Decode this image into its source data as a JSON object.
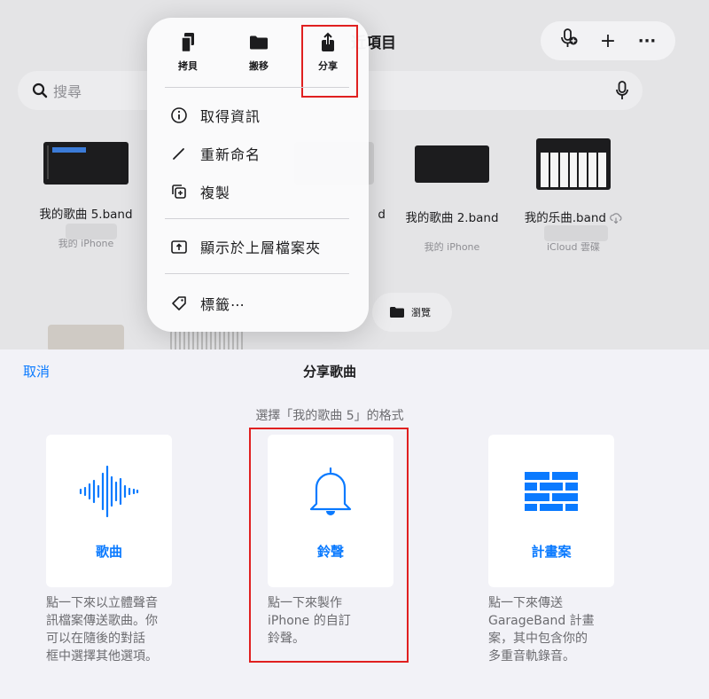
{
  "background": {
    "title_partial": "近項目",
    "search_placeholder": "搜尋",
    "toolbar": {
      "mic_add_icon": "mic-plus-icon",
      "add_icon": "plus-icon",
      "more_icon": "ellipsis-icon",
      "add_label": "+",
      "more_label": "···"
    },
    "files": [
      {
        "name": "我的歌曲 5.band",
        "location": "我的 iPhone"
      },
      {
        "name": "d",
        "location": ""
      },
      {
        "name": "我的歌曲 2.band",
        "location": "我的 iPhone"
      },
      {
        "name": "我的乐曲.band",
        "location": "iCloud 雲碟"
      }
    ],
    "browse_label": "瀏覽"
  },
  "menu": {
    "quick_actions": [
      {
        "label": "拷貝",
        "icon": "copy-doc-icon"
      },
      {
        "label": "搬移",
        "icon": "folder-icon"
      },
      {
        "label": "分享",
        "icon": "share-icon"
      }
    ],
    "items": [
      {
        "label": "取得資訊",
        "icon": "info-icon"
      },
      {
        "label": "重新命名",
        "icon": "pencil-icon"
      },
      {
        "label": "複製",
        "icon": "duplicate-icon"
      },
      {
        "label": "顯示於上層檔案夾",
        "icon": "folder-up-icon"
      },
      {
        "label": "標籤⋯",
        "icon": "tag-icon"
      }
    ]
  },
  "sheet": {
    "cancel_label": "取消",
    "title": "分享歌曲",
    "subtitle": "選擇「我的歌曲 5」的格式",
    "options": [
      {
        "label": "歌曲",
        "icon": "waveform-icon",
        "description": [
          "點一下來以立體聲音",
          "訊檔案傳送歌曲。你",
          "可以在隨後的對話",
          "框中選擇其他選項。"
        ]
      },
      {
        "label": "鈴聲",
        "icon": "bell-icon",
        "description": [
          "點一下來製作",
          "iPhone 的自訂",
          "鈴聲。"
        ]
      },
      {
        "label": "計畫案",
        "icon": "bricks-icon",
        "description": [
          "點一下來傳送",
          "GarageBand 計畫",
          "案，其中包含你的",
          "多重音軌錄音。"
        ]
      }
    ]
  },
  "colors": {
    "accent": "#0a7aff",
    "highlight": "#e02020"
  }
}
